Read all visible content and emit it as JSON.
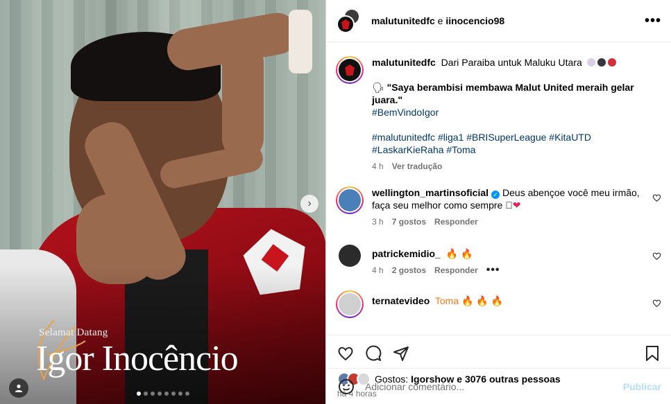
{
  "media": {
    "welcome_text": "Selamat Datang",
    "player_name": "Igor Inocêncio",
    "carousel": {
      "count": 8,
      "active_index": 0
    }
  },
  "header": {
    "user_primary": "malutunitedfc",
    "conjunction": "e",
    "user_secondary": "iinocencio98",
    "more_label": "•••"
  },
  "caption": {
    "username": "malutunitedfc",
    "text_line1": "Dari Paraiba untuk Maluku Utara",
    "emoji_dots": [
      "#d9cfe6",
      "#3a3640",
      "#d4303c"
    ],
    "quote_icon": "🗣",
    "quote": "\"Saya berambisi membawa Malut United meraih gelar juara.\"",
    "hashtag_welcome": "#BemVindoIgor",
    "hashtags_line1": "#malutunitedfc #liga1 #BRISuperLeague #KitaUTD",
    "hashtags_line2": "#LaskarKieRaha #Toma",
    "time": "4 h",
    "translate": "Ver tradução"
  },
  "comments": [
    {
      "username": "wellington_martinsoficial",
      "verified": true,
      "text": "Deus abençoe você meu irmão, faça seu melhor como sempre",
      "emoji": "🏾❤",
      "time": "3 h",
      "likes": "7 gostos",
      "reply": "Responder",
      "avatar_color": "#4a7fb8",
      "has_story": true
    },
    {
      "username": "patrickemidio_",
      "verified": false,
      "text": "🔥 🔥",
      "time": "4 h",
      "likes": "2 gostos",
      "reply": "Responder",
      "more": "•••",
      "avatar_color": "#2b2b2b",
      "has_story": false
    },
    {
      "username": "ternatevideo",
      "verified": false,
      "text": "Toma 🔥 🔥 🔥",
      "avatar_color": "#d0d0d0",
      "has_story": true
    }
  ],
  "likes_bar": {
    "prefix": "Gostos:",
    "user": "Igorshow",
    "suffix": "e 3076 outras pessoas",
    "mini_avatars": [
      "#5f7ca8",
      "#c23a30",
      "#d9d9d9"
    ]
  },
  "post_time": "há 4 horas",
  "add_comment": {
    "placeholder": "Adicionar comentário...",
    "publish_label": "Publicar"
  }
}
